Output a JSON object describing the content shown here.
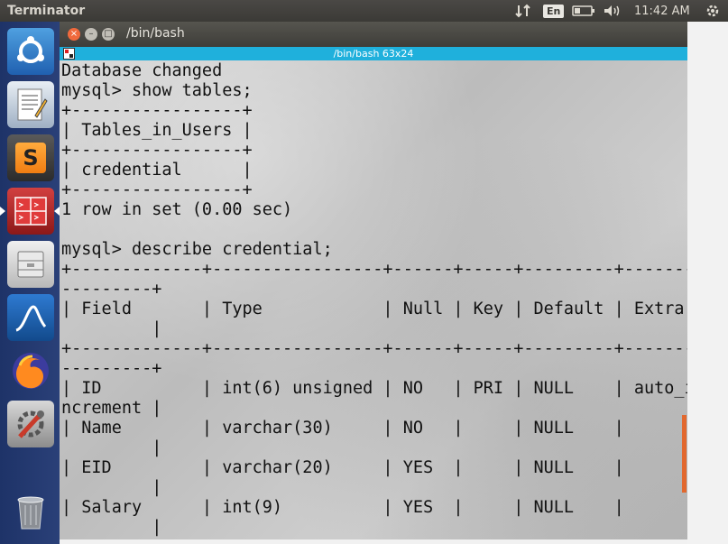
{
  "top_panel": {
    "app_title": "Terminator",
    "language": "En",
    "clock": "11:42 AM"
  },
  "launcher": {
    "items": [
      {
        "name": "ubuntu-dash",
        "icon": "ubuntu-logo-icon"
      },
      {
        "name": "text-editor",
        "icon": "text-editor-icon"
      },
      {
        "name": "sublime-text",
        "icon": "sublime-icon",
        "glyph": "S"
      },
      {
        "name": "terminator",
        "icon": "terminator-icon",
        "active": true
      },
      {
        "name": "file-manager",
        "icon": "file-cabinet-icon"
      },
      {
        "name": "wireshark",
        "icon": "wireshark-fin-icon"
      },
      {
        "name": "firefox",
        "icon": "firefox-icon"
      },
      {
        "name": "system-settings",
        "icon": "settings-tools-icon"
      },
      {
        "name": "trash",
        "icon": "trash-icon"
      }
    ]
  },
  "window": {
    "title": "/bin/bash",
    "tab_title": "/bin/bash 63x24",
    "close_glyph": "×",
    "min_glyph": "–",
    "max_glyph": "□"
  },
  "terminal": {
    "lines": [
      "Database changed",
      "mysql> show tables;",
      "+-----------------+",
      "| Tables_in_Users |",
      "+-----------------+",
      "| credential      |",
      "+-----------------+",
      "1 row in set (0.00 sec)",
      "",
      "mysql> describe credential;",
      "+-------------+-----------------+------+-----+---------+-------",
      "---------+",
      "| Field       | Type            | Null | Key | Default | Extra ",
      "         |",
      "+-------------+-----------------+------+-----+---------+-------",
      "---------+",
      "| ID          | int(6) unsigned | NO   | PRI | NULL    | auto_i",
      "ncrement |",
      "| Name        | varchar(30)     | NO   |     | NULL    |       ",
      "         |",
      "| EID         | varchar(20)     | YES  |     | NULL    |       ",
      "         |",
      "| Salary      | int(9)          | YES  |     | NULL    |       ",
      "         |"
    ]
  },
  "colors": {
    "tab_bar": "#1fb0dc",
    "close_button": "#f0693c",
    "scrollbar": "#e2682e",
    "launcher": "#243a70"
  }
}
